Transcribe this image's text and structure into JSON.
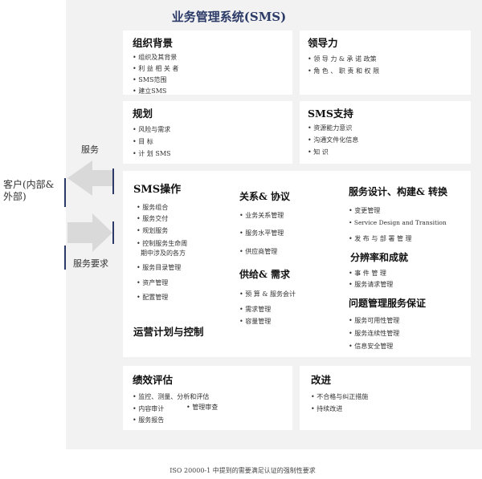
{
  "title": "业务管理系统(SMS)",
  "customer": {
    "line1": "客户(内部&",
    "line2": "外部)"
  },
  "side": {
    "service": "服务",
    "requirement": "服务要求"
  },
  "org": {
    "heading": "组织背景",
    "items": [
      "组织及其背景",
      "利 益 相 关 者",
      "SMS范围",
      "建立SMS"
    ]
  },
  "leadership": {
    "heading": "领导力",
    "items": [
      "领 导 力 & 承 诺 政策",
      "角 色 、 职 责 和 权 限"
    ]
  },
  "planning": {
    "heading": "规划",
    "items": [
      "风险与需求",
      "目 标",
      "计 划 SMS"
    ]
  },
  "support": {
    "heading": "SMS支持",
    "items": [
      "资源能力意识",
      "沟通文件化信息",
      "知 识"
    ]
  },
  "operation": {
    "heading": "SMS操作",
    "items": [
      "服务组合",
      "服务交付",
      "规划服务",
      "控制服务生命周",
      "期中涉及的各方",
      "服务目录管理",
      "资产管理",
      "配置管理"
    ],
    "sub_heading": "运营计划与控制"
  },
  "relationship": {
    "heading": "关系& 协议",
    "items": [
      "业务关系管理",
      "服务水平管理",
      "供应商管理"
    ]
  },
  "supply": {
    "heading": "供给& 需求",
    "items": [
      "预 算 & 服务会计",
      "需求管理",
      "容量管理"
    ]
  },
  "design": {
    "heading": "服务设计、构建& 转换",
    "items": [
      "变更管理",
      "Service Design and Transition",
      "发 布 与 部 署 管 理"
    ]
  },
  "resolution": {
    "heading": "分辨率和成就",
    "items": [
      "事 件 管 理",
      "服务请求管理"
    ]
  },
  "assurance": {
    "heading": "问题管理服务保证",
    "items": [
      "服务可用性管理",
      "服务连续性管理",
      "信息安全管理"
    ]
  },
  "evaluation": {
    "heading": "绩效评估",
    "items": [
      "监控、测量、分析和评估",
      "内容审计",
      "管理审查",
      "服务报告"
    ]
  },
  "improvement": {
    "heading": "改进",
    "items": [
      "不合格与纠正措施",
      "持续改进"
    ]
  },
  "footer": "ISO 20000-1 中提到的需要满足认证的强制性要求",
  "colors": {
    "title": "#2b3a67",
    "panel": "#f2f2f2",
    "box": "#ffffff",
    "arrow": "#d9d9d9"
  }
}
